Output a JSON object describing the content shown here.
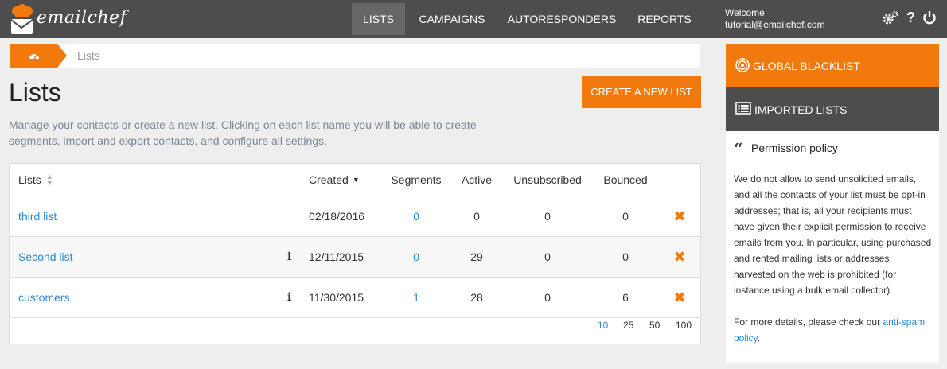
{
  "brand": {
    "name": "emailchef",
    "accent": "#f27a0d",
    "dark": "#4d4d4d",
    "link": "#2a8ad1"
  },
  "nav": {
    "items": [
      {
        "label": "LISTS",
        "active": true
      },
      {
        "label": "CAMPAIGNS",
        "active": false
      },
      {
        "label": "AUTORESPONDERS",
        "active": false
      },
      {
        "label": "REPORTS",
        "active": false
      }
    ]
  },
  "user": {
    "welcome": "Welcome",
    "email": "tutorial@emailchef.com"
  },
  "top_icons": [
    "gears-icon",
    "help-icon",
    "power-icon"
  ],
  "breadcrumb": {
    "home_icon": "dashboard-icon",
    "current": "Lists"
  },
  "page": {
    "title": "Lists",
    "description": "Manage your contacts or create a new list. Clicking on each list name you will be able to create segments, import and export contacts, and configure all settings.",
    "create_button": "CREATE A NEW LIST"
  },
  "table": {
    "headers": [
      "Lists",
      "Created",
      "Segments",
      "Active",
      "Unsubscribed",
      "Bounced"
    ],
    "rows": [
      {
        "name": "third list",
        "info": false,
        "created": "02/18/2016",
        "segments": "0",
        "active": "0",
        "unsubscribed": "0",
        "bounced": "0"
      },
      {
        "name": "Second list",
        "info": true,
        "created": "12/11/2015",
        "segments": "0",
        "active": "29",
        "unsubscribed": "0",
        "bounced": "0"
      },
      {
        "name": "customers",
        "info": true,
        "created": "11/30/2015",
        "segments": "1",
        "active": "28",
        "unsubscribed": "0",
        "bounced": "6"
      }
    ],
    "page_sizes": [
      "10",
      "25",
      "50",
      "100"
    ],
    "selected_page_size": "10"
  },
  "sidebar": {
    "global_blacklist": "GLOBAL BLACKLIST",
    "imported_lists": "IMPORTED LISTS",
    "policy_title": "Permission policy",
    "policy_text": "We do not allow to send unsolicited emails, and all the contacts of your list must be opt-in addresses; that is, all your recipients must have given their explicit permission to receive emails from you. In particular, using purchased and rented mailing lists or addresses harvested on the web is prohibited (for instance using a bulk email collector).",
    "policy_more_prefix": "For more details, please check our ",
    "policy_more_link": "anti-spam policy",
    "policy_more_suffix": "."
  }
}
